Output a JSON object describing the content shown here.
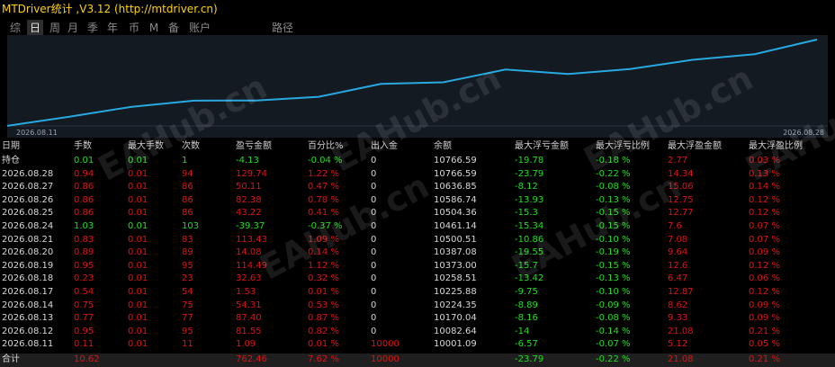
{
  "title": "MTDriver统计 ,V3.12 (http://mtdriver.cn)",
  "tabs": [
    "综",
    "日",
    "周",
    "月",
    "季",
    "年",
    "币",
    "M",
    "备",
    "账户",
    "路径"
  ],
  "active_tab": "日",
  "chart": {
    "x_start": "2026.08.11",
    "x_end": "2026.08.28",
    "line_color": "#29a8e0"
  },
  "headers": [
    "日期",
    "手数",
    "最大手数",
    "次数",
    "盈亏金额",
    "百分比%",
    "出入金",
    "余额",
    "最大浮亏金额",
    "最大浮亏比例",
    "最大浮盈金额",
    "最大浮盈比例"
  ],
  "rows": [
    [
      "持仓",
      "0.01",
      "0.01",
      "1",
      "-4.13",
      "-0.04 %",
      "0",
      "10766.59",
      "-19.78",
      "-0.18 %",
      "2.77",
      "0.03 %"
    ],
    [
      "2026.08.28",
      "0.94",
      "0.01",
      "94",
      "129.74",
      "1.22 %",
      "0",
      "10766.59",
      "-23.79",
      "-0.22 %",
      "14.34",
      "0.13 %"
    ],
    [
      "2026.08.27",
      "0.86",
      "0.01",
      "86",
      "50.11",
      "0.47 %",
      "0",
      "10636.85",
      "-8.12",
      "-0.08 %",
      "15.06",
      "0.14 %"
    ],
    [
      "2026.08.26",
      "0.86",
      "0.01",
      "86",
      "82.38",
      "0.78 %",
      "0",
      "10586.74",
      "-13.93",
      "-0.13 %",
      "12.75",
      "0.12 %"
    ],
    [
      "2026.08.25",
      "0.86",
      "0.01",
      "86",
      "43.22",
      "0.41 %",
      "0",
      "10504.36",
      "-15.3",
      "-0.15 %",
      "12.77",
      "0.12 %"
    ],
    [
      "2026.08.24",
      "1.03",
      "0.01",
      "103",
      "-39.37",
      "-0.37 %",
      "0",
      "10461.14",
      "-15.34",
      "-0.15 %",
      "7.6",
      "0.07 %"
    ],
    [
      "2026.08.21",
      "0.83",
      "0.01",
      "83",
      "113.43",
      "1.09 %",
      "0",
      "10500.51",
      "-10.86",
      "-0.10 %",
      "7.08",
      "0.07 %"
    ],
    [
      "2026.08.20",
      "0.89",
      "0.01",
      "89",
      "14.08",
      "0.14 %",
      "0",
      "10387.08",
      "-19.55",
      "-0.19 %",
      "9.64",
      "0.09 %"
    ],
    [
      "2026.08.19",
      "0.95",
      "0.01",
      "95",
      "114.49",
      "1.12 %",
      "0",
      "10373.00",
      "-15.7",
      "-0.15 %",
      "12.6",
      "0.12 %"
    ],
    [
      "2026.08.18",
      "0.23",
      "0.01",
      "23",
      "32.63",
      "0.32 %",
      "0",
      "10258.51",
      "-13.42",
      "-0.13 %",
      "6.47",
      "0.06 %"
    ],
    [
      "2026.08.17",
      "0.54",
      "0.01",
      "54",
      "1.53",
      "0.01 %",
      "0",
      "10225.88",
      "-9.75",
      "-0.10 %",
      "12.87",
      "0.12 %"
    ],
    [
      "2026.08.14",
      "0.75",
      "0.01",
      "75",
      "54.31",
      "0.53 %",
      "0",
      "10224.35",
      "-8.89",
      "-0.09 %",
      "8.62",
      "0.09 %"
    ],
    [
      "2026.08.13",
      "0.77",
      "0.01",
      "77",
      "87.40",
      "0.87 %",
      "0",
      "10170.04",
      "-8.16",
      "-0.08 %",
      "9.33",
      "0.09 %"
    ],
    [
      "2026.08.12",
      "0.95",
      "0.01",
      "95",
      "81.55",
      "0.82 %",
      "0",
      "10082.64",
      "-14",
      "-0.14 %",
      "21.08",
      "0.21 %"
    ],
    [
      "2026.08.11",
      "0.11",
      "0.01",
      "11",
      "1.09",
      "0.01 %",
      "10000",
      "10001.09",
      "-6.57",
      "-0.07 %",
      "5.12",
      "0.05 %"
    ]
  ],
  "total": [
    "合计",
    "10.62",
    "",
    "",
    "762.46",
    "7.62 %",
    "10000",
    "",
    "-23.79",
    "-0.22 %",
    "21.08",
    "0.21 %"
  ],
  "balance_series": [
    {
      "date": "2026.08.11",
      "balance": 10001.09
    },
    {
      "date": "2026.08.12",
      "balance": 10082.64
    },
    {
      "date": "2026.08.13",
      "balance": 10170.04
    },
    {
      "date": "2026.08.14",
      "balance": 10224.35
    },
    {
      "date": "2026.08.17",
      "balance": 10225.88
    },
    {
      "date": "2026.08.18",
      "balance": 10258.51
    },
    {
      "date": "2026.08.19",
      "balance": 10373.0
    },
    {
      "date": "2026.08.20",
      "balance": 10387.08
    },
    {
      "date": "2026.08.21",
      "balance": 10500.51
    },
    {
      "date": "2026.08.24",
      "balance": 10461.14
    },
    {
      "date": "2026.08.25",
      "balance": 10504.36
    },
    {
      "date": "2026.08.26",
      "balance": 10586.74
    },
    {
      "date": "2026.08.27",
      "balance": 10636.85
    },
    {
      "date": "2026.08.28",
      "balance": 10766.59
    }
  ],
  "watermark": "EAHub.cn"
}
